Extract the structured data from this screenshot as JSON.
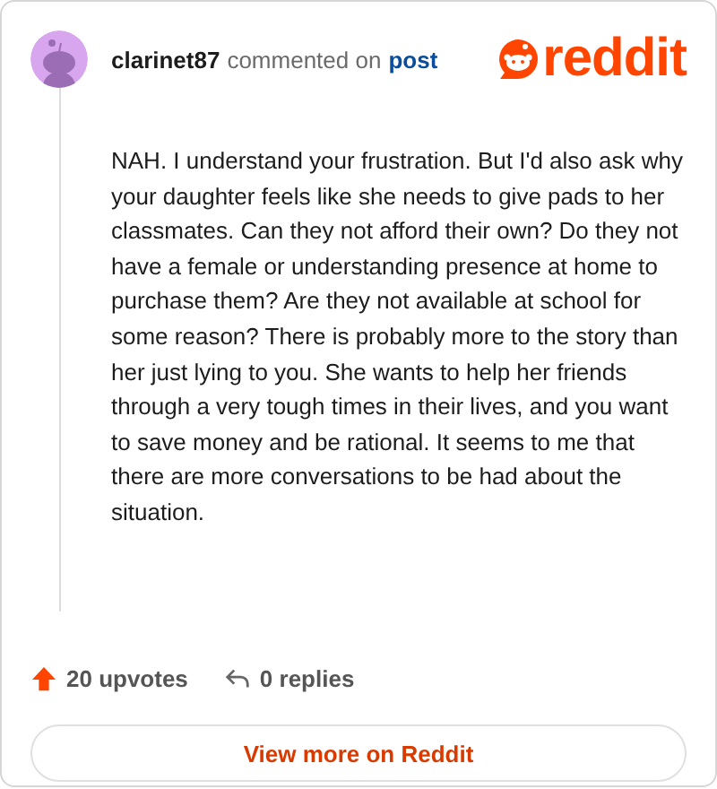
{
  "comment": {
    "author": "clarinet87",
    "action": "commented on",
    "target": "post",
    "body": "NAH. I understand your frustration. But I'd also ask why your daughter feels like she needs to give pads to her classmates. Can they not afford their own? Do they not have a female or understanding presence at home to purchase them? Are they not available at school for some reason? There is probably more to the story than her just lying to you. She wants to help her friends through a very tough times in their lives, and you want to save money and be rational. It seems to me that there are more conversations to be had about the situation."
  },
  "logo": {
    "text": "reddit"
  },
  "stats": {
    "upvotes": "20 upvotes",
    "replies": "0 replies"
  },
  "button": {
    "label": "View more on Reddit"
  }
}
